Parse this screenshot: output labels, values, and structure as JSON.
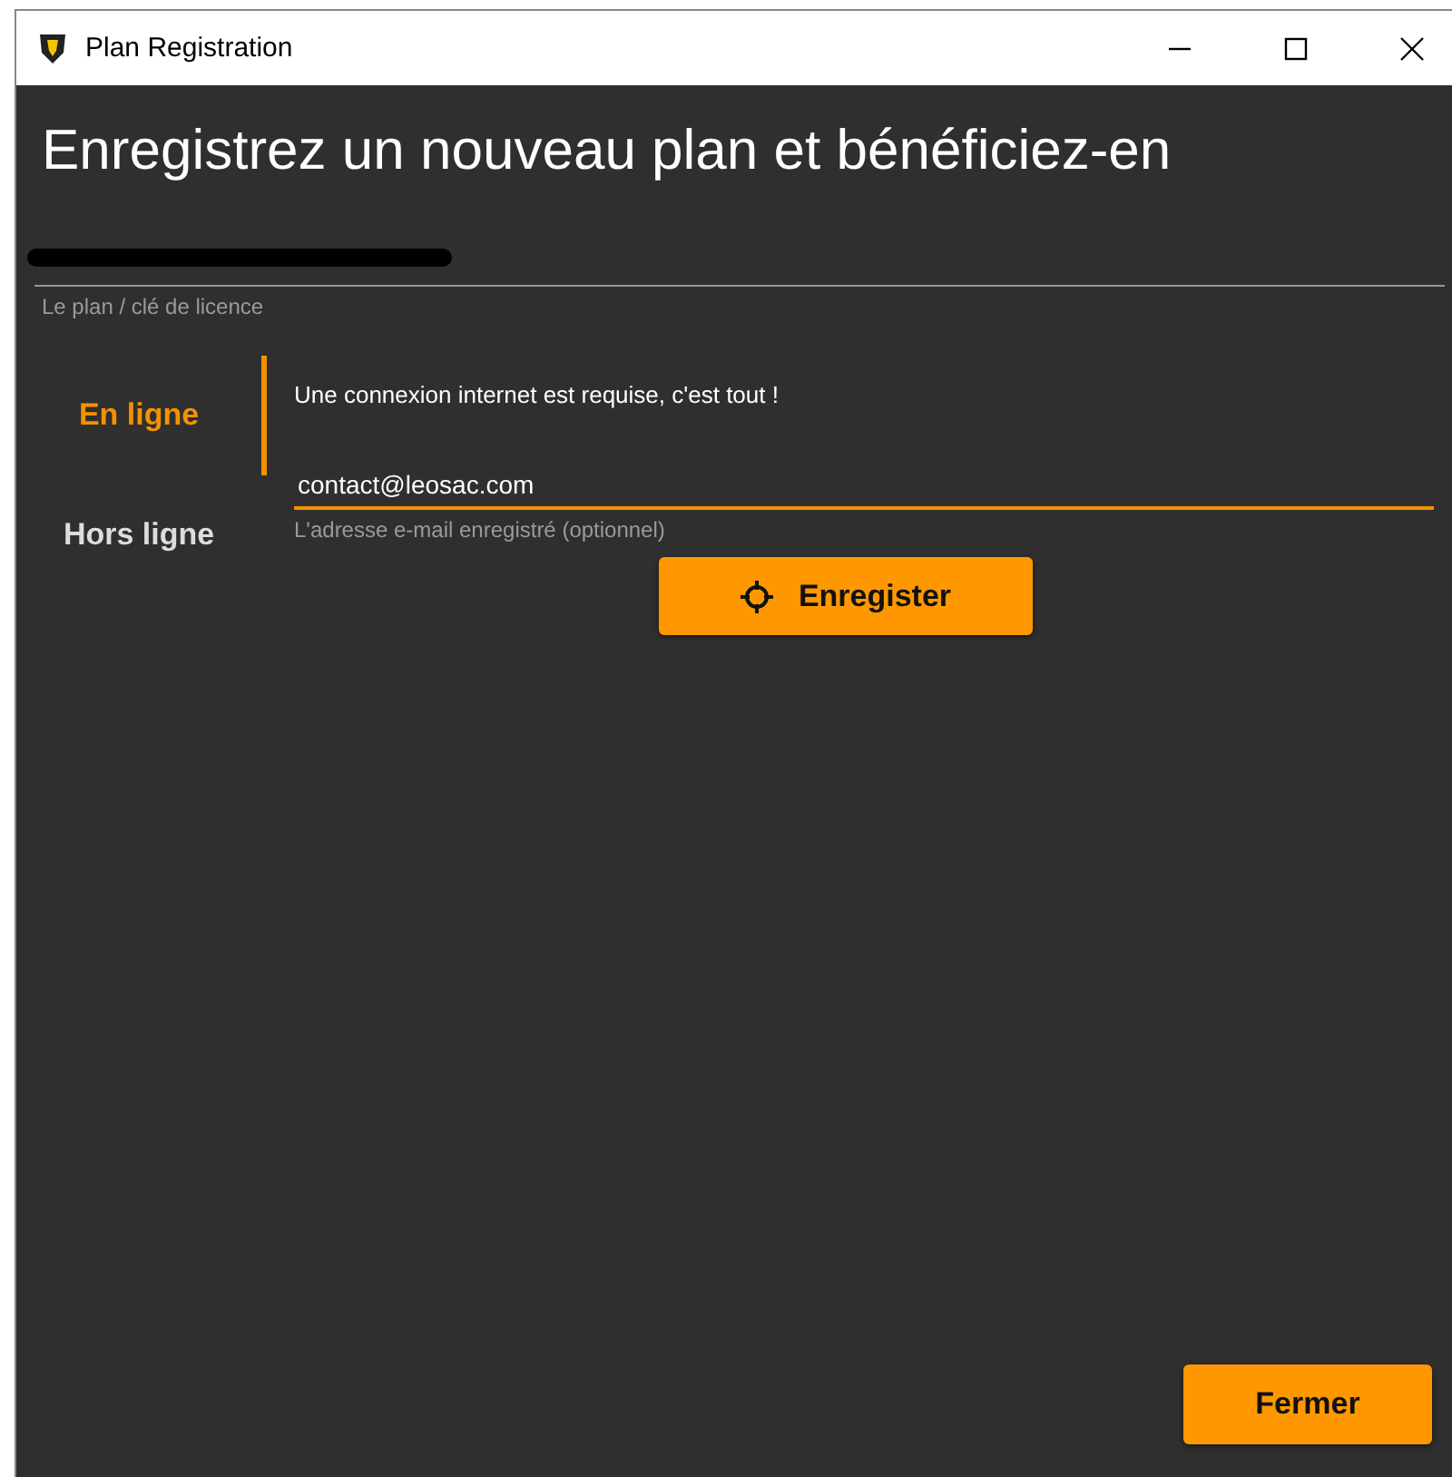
{
  "window": {
    "title": "Plan Registration"
  },
  "heading": "Enregistrez un nouveau plan et bénéficiez-en",
  "license_field": {
    "label": "Le plan / clé de licence"
  },
  "tabs": [
    {
      "label": "En ligne",
      "selected": true
    },
    {
      "label": "Hors ligne",
      "selected": false
    }
  ],
  "online_panel": {
    "message": "Une connexion internet est requise, c'est tout !",
    "email_field": {
      "value": "contact@leosac.com",
      "label": "L'adresse e-mail enregistré (optionnel)"
    },
    "register_button": "Enregister"
  },
  "close_button": "Fermer"
}
